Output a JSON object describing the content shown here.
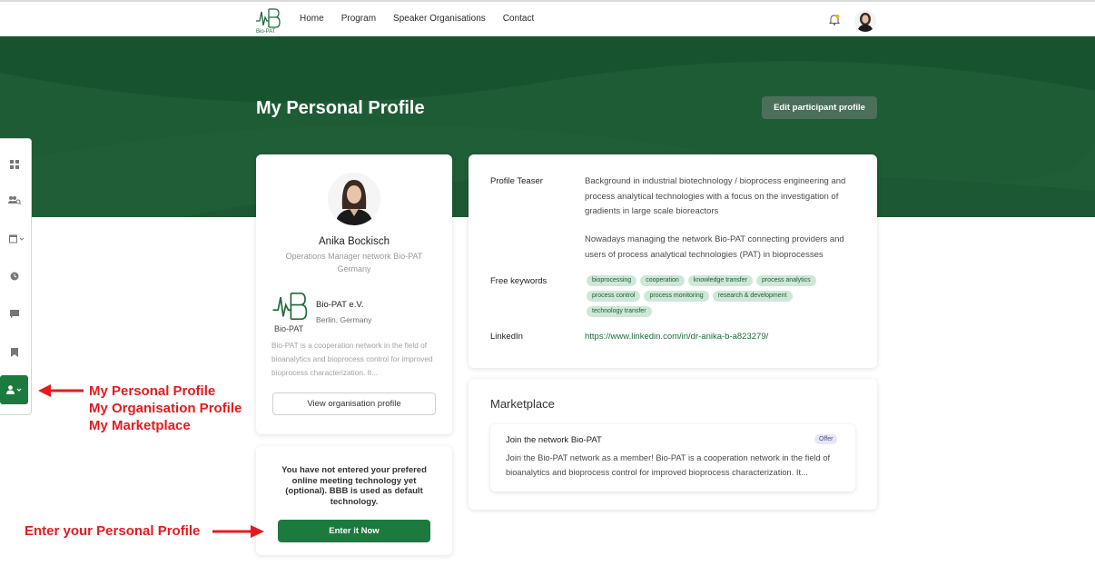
{
  "nav": {
    "logo_text": "Bio-PAT",
    "links": [
      "Home",
      "Program",
      "Speaker Organisations",
      "Contact"
    ]
  },
  "hero": {
    "title": "My Personal Profile",
    "edit_button": "Edit participant profile"
  },
  "profile": {
    "name": "Anika Bockisch",
    "role": "Operations Manager network Bio-PAT",
    "location": "Germany",
    "org_name": "Bio-PAT e.V.",
    "org_city": "Berlin, Germany",
    "org_logo_text": "Bio-PAT",
    "org_description": "Bio-PAT is a cooperation network in the field of bioanalytics and bioprocess control for improved bioprocess characterization. It...",
    "view_org_button": "View organisation profile"
  },
  "meeting": {
    "notice": "You have not entered your prefered online meeting technology yet (optional). BBB is used as default technology.",
    "enter_button": "Enter it Now"
  },
  "info": {
    "teaser_label": "Profile Teaser",
    "teaser_p1": "Background in industrial biotechnology / bioprocess engineering and process analytical technologies with a focus on the investigation of gradients in large scale bioreactors",
    "teaser_p2": "Nowadays managing the network Bio-PAT connecting providers and users of process analytical technologies (PAT) in bioprocesses",
    "keywords_label": "Free keywords",
    "keywords": [
      "bioprocessing",
      "cooperation",
      "knowledge transfer",
      "process analytics",
      "process control",
      "process monitoring",
      "research & development",
      "technology transfer"
    ],
    "linkedin_label": "LinkedIn",
    "linkedin_url": "https://www.linkedin.com/in/dr-anika-b-a823279/"
  },
  "marketplace": {
    "title": "Marketplace",
    "item_title": "Join the network Bio-PAT",
    "item_badge": "Offer",
    "item_desc": "Join the Bio-PAT network as a member! Bio-PAT is a cooperation network in the field of bioanalytics and bioprocess control for improved bioprocess characterization. It..."
  },
  "annotations": {
    "menu_lines": [
      "My Personal Profile",
      "My Organisation Profile",
      "My Marketplace"
    ],
    "enter_label": "Enter your Personal Profile",
    "color": "#e8191e"
  },
  "colors": {
    "primary_green": "#1d7a3e",
    "hero_green": "#1d5c35",
    "keyword_bg": "#cde8d6"
  },
  "icons": [
    "logo-icon",
    "bell-icon",
    "avatar",
    "dashboard-icon",
    "people-search-icon",
    "calendar-icon",
    "clock-icon",
    "chat-icon",
    "bookmark-icon",
    "person-icon"
  ]
}
